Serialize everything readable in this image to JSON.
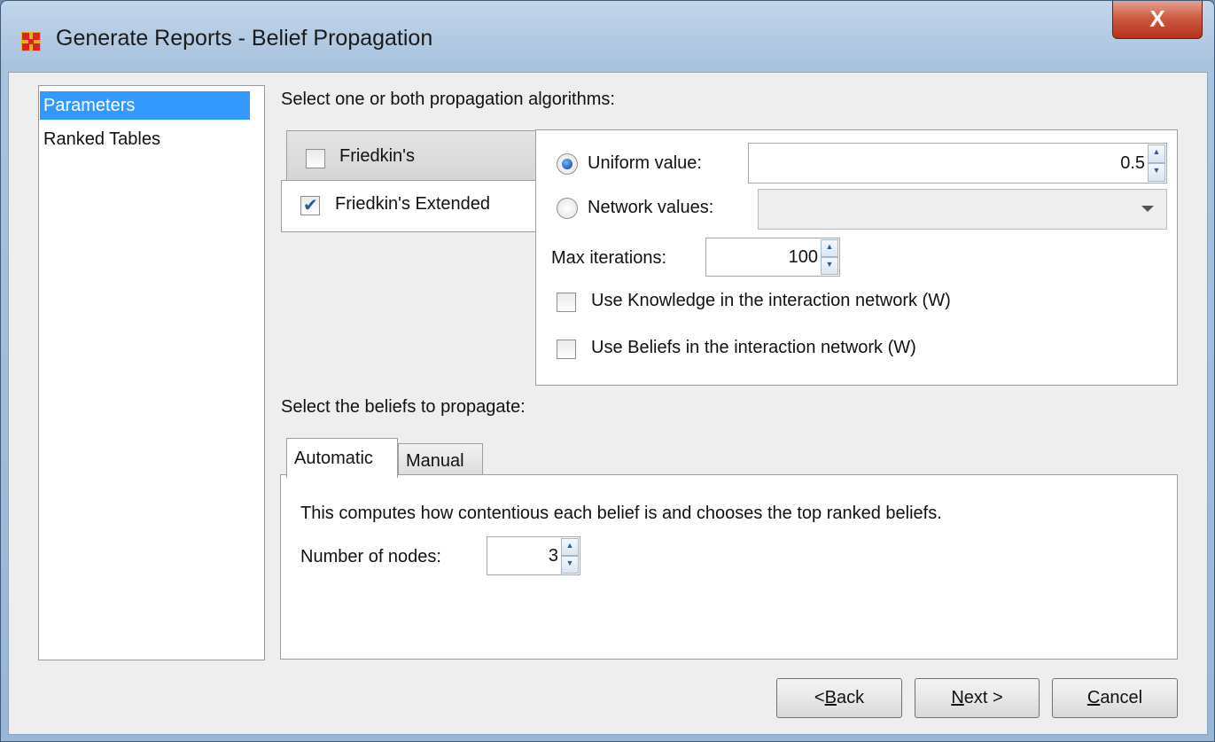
{
  "window": {
    "title": "Generate Reports - Belief Propagation",
    "close_label": "X"
  },
  "sidebar": {
    "items": [
      {
        "label": "Parameters",
        "selected": true
      },
      {
        "label": "Ranked Tables",
        "selected": false
      }
    ]
  },
  "algorithms": {
    "heading": "Select one or both propagation algorithms:",
    "friedkin": {
      "label": "Friedkin's",
      "checked": false
    },
    "friedkin_extended": {
      "label": "Friedkin's Extended",
      "checked": true
    }
  },
  "options": {
    "uniform_label": "Uniform value:",
    "uniform_value": "0.5",
    "network_label": "Network values:",
    "network_value": "",
    "max_iterations_label": "Max iterations:",
    "max_iterations_value": "100",
    "use_knowledge_label": "Use Knowledge in the interaction network (W)",
    "use_beliefs_label": "Use Beliefs in the interaction network (W)"
  },
  "beliefs": {
    "heading": "Select the beliefs to propagate:",
    "tabs": [
      {
        "label": "Automatic",
        "active": true
      },
      {
        "label": "Manual",
        "active": false
      }
    ],
    "description": "This computes how contentious each belief is and chooses the top ranked beliefs.",
    "nodes_label": "Number of nodes:",
    "nodes_value": "3"
  },
  "buttons": {
    "back": {
      "prefix": "< ",
      "mnemonic": "B",
      "rest": "ack"
    },
    "next": {
      "prefix": "",
      "mnemonic": "N",
      "rest": "ext >"
    },
    "cancel": {
      "prefix": "",
      "mnemonic": "C",
      "rest": "ancel"
    }
  },
  "icons": {
    "app": "network-grid-icon",
    "close": "close-icon",
    "spinner_up": "arrow-up-icon",
    "spinner_down": "arrow-down-icon",
    "dropdown": "chevron-down-icon"
  },
  "colors": {
    "selection": "#3399ff",
    "close_button": "#c8482f",
    "frame": "#a9c3df"
  }
}
